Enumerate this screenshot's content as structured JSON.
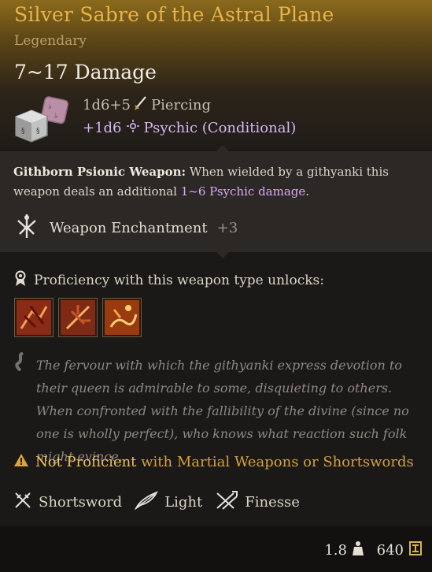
{
  "item": {
    "name": "Silver Sabre of the Astral Plane",
    "rarity": "Legendary",
    "damage_total": "7~17 Damage",
    "damage_lines": [
      {
        "dice": "1d6+5",
        "type": "Piercing",
        "icon": "sword-icon"
      },
      {
        "dice": "+1d6",
        "type": "Psychic (Conditional)",
        "icon": "psychic-icon"
      }
    ]
  },
  "passive": {
    "name": "Githborn Psionic Weapon:",
    "text": " When wielded by a githyanki this weapon deals an additional ",
    "highlight": "1~6 Psychic damage",
    "end": "."
  },
  "enchantment": {
    "label": "Weapon Enchantment",
    "value": "+3",
    "icon": "enchantment-icon"
  },
  "proficiency": {
    "header": "Proficiency with this weapon type unlocks:",
    "skills": [
      {
        "icon": "action-skill-1-icon"
      },
      {
        "icon": "action-skill-2-icon"
      },
      {
        "icon": "action-skill-3-icon"
      }
    ]
  },
  "lore": "The fervour with which the githyanki express devotion to their queen is admirable to some, disquieting to others. When confronted with the fallibility of the divine (since no one is wholly perfect), who knows what reaction such folk might evince.",
  "warning": {
    "np": "Not Proficient",
    "rest": " with Martial Weapons or Shortswords"
  },
  "properties": [
    {
      "label": "Shortsword",
      "icon": "shortsword-icon"
    },
    {
      "label": "Light",
      "icon": "light-icon"
    },
    {
      "label": "Finesse",
      "icon": "finesse-icon"
    }
  ],
  "footer": {
    "weight": "1.8",
    "value": "640"
  },
  "colors": {
    "title": "#e8b34a",
    "psychic": "#d9b6f2",
    "warning": "#d4a03c"
  }
}
